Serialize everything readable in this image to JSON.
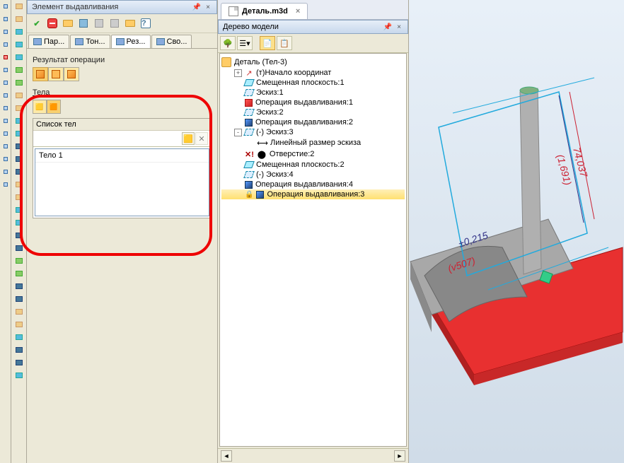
{
  "left_panel": {
    "title": "Элемент выдавливания",
    "tabs": [
      {
        "label": "Пар..."
      },
      {
        "label": "Тон..."
      },
      {
        "label": "Рез..."
      },
      {
        "label": "Сво..."
      }
    ],
    "active_tab": 2,
    "result_label": "Результат операции",
    "bodies_label": "Тела",
    "list_label": "Список тел",
    "list_items": [
      "Тело 1"
    ]
  },
  "doc_tab": {
    "label": "Деталь.m3d"
  },
  "tree_panel": {
    "title": "Дерево модели",
    "root": "Деталь (Тел-3)",
    "items": [
      {
        "label": "(т)Начало координат",
        "icon": "axis",
        "indent": 1,
        "exp": "+"
      },
      {
        "label": "Смещенная плоскость:1",
        "icon": "plane",
        "indent": 1
      },
      {
        "label": "Эскиз:1",
        "icon": "sketch",
        "indent": 1
      },
      {
        "label": "Операция выдавливания:1",
        "icon": "extrude",
        "indent": 1
      },
      {
        "label": "Эскиз:2",
        "icon": "sketch",
        "indent": 1
      },
      {
        "label": "Операция выдавливания:2",
        "icon": "extrude-b",
        "indent": 1
      },
      {
        "label": "(-) Эскиз:3",
        "icon": "sketch",
        "indent": 1,
        "exp": "-"
      },
      {
        "label": "Линейный размер эскиза",
        "icon": "dim",
        "indent": 2
      },
      {
        "label": "Отверстие:2",
        "icon": "hole",
        "indent": 1,
        "excl": true
      },
      {
        "label": "Смещенная плоскость:2",
        "icon": "plane",
        "indent": 1
      },
      {
        "label": "(-) Эскиз:4",
        "icon": "sketch",
        "indent": 1
      },
      {
        "label": "Операция выдавливания:4",
        "icon": "extrude-b",
        "indent": 1
      },
      {
        "label": "Операция выдавливания:3",
        "icon": "extrude-b",
        "indent": 1,
        "lock": true,
        "sel": true
      }
    ]
  },
  "viewport": {
    "dims": {
      "d1": "±0,215",
      "d2": "(v507)",
      "d3": "74,037",
      "d4": "(1,691)"
    }
  }
}
